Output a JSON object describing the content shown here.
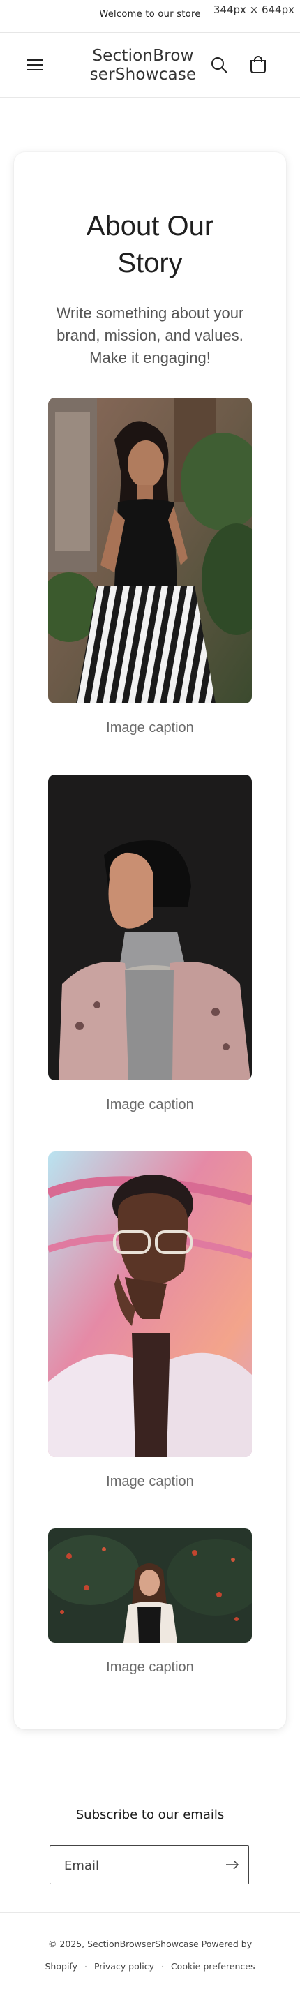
{
  "announcement": {
    "text": "Welcome to our store",
    "dimensions_label": "344px × 644px"
  },
  "header": {
    "logo": "SectionBrowserShowcase",
    "logo_line1": "SectionBrow",
    "logo_line2": "serShowcase"
  },
  "icons": {
    "menu": "hamburger-icon",
    "search": "search-icon",
    "cart": "cart-icon",
    "submit": "arrow-right-icon"
  },
  "story": {
    "title": "About Our Story",
    "description": "Write something about your brand, mission, and values. Make it engaging!",
    "images": [
      {
        "caption": "Image caption",
        "subject": "woman seated in striped pants among plants"
      },
      {
        "caption": "Image caption",
        "subject": "woman in head wrap, profile view, dark background"
      },
      {
        "caption": "Image caption",
        "subject": "woman with glasses and fur coat, colorful background"
      },
      {
        "caption": "Image caption",
        "subject": "woman among red flowering shrubs"
      }
    ]
  },
  "newsletter": {
    "heading": "Subscribe to our emails",
    "placeholder": "Email"
  },
  "footer": {
    "copyright": "© 2025, SectionBrowserShowcase Powered by",
    "links": [
      "Shopify",
      "Privacy policy",
      "Cookie preferences"
    ]
  },
  "colors": {
    "text": "#1a1a1a",
    "muted": "#6b6b6b",
    "border": "#e8e8e8"
  }
}
